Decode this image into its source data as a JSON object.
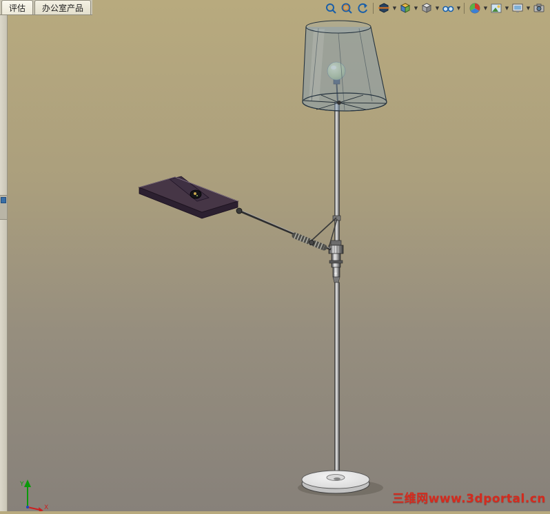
{
  "tabs": [
    {
      "label": "评估"
    },
    {
      "label": "办公室产品"
    }
  ],
  "toolbar": {
    "icons": [
      "zoom-to-fit",
      "zoom-to-area",
      "previous-view",
      "section-view",
      "view-orientation",
      "display-style",
      "hide-show-items",
      "edit-appearance",
      "apply-scene",
      "view-settings",
      "camera"
    ]
  },
  "viewport": {
    "watermark": "三维网www.3dportal.cn",
    "triad": {
      "x_label": "X",
      "y_label": "Y"
    }
  },
  "colors": {
    "background_top": "#b8aa7e",
    "background_bottom": "#87817a",
    "shade_blue": "#7f9cb8",
    "watermark_red": "#d42b1e",
    "tab_face": "#ece8d8"
  }
}
